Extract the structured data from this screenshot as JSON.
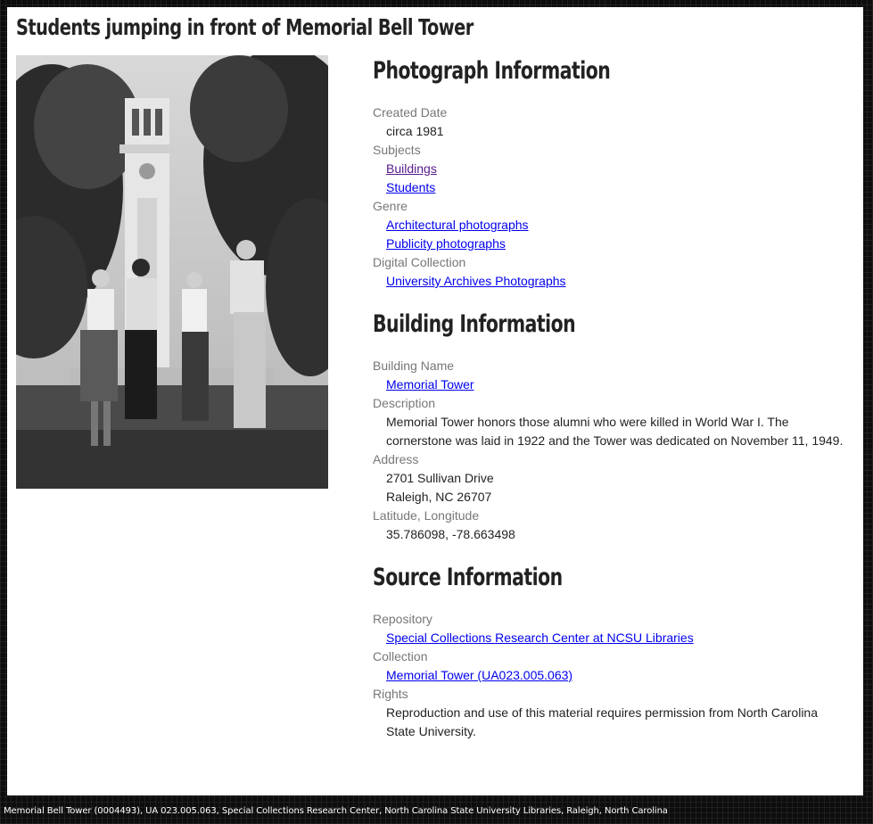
{
  "page": {
    "title": "Students jumping in front of Memorial Bell Tower",
    "footer_caption": "Memorial Bell Tower (0004493), UA 023.005.063, Special Collections Research Center, North Carolina State University Libraries, Raleigh, North Carolina"
  },
  "photo": {
    "description_icon": "black-and-white-photograph"
  },
  "photograph_information": {
    "heading": "Photograph Information",
    "created_date_label": "Created Date",
    "created_date": "circa 1981",
    "subjects_label": "Subjects",
    "subjects": [
      "Buildings",
      "Students"
    ],
    "genre_label": "Genre",
    "genre": [
      "Architectural photographs",
      "Publicity photographs"
    ],
    "digital_collection_label": "Digital Collection",
    "digital_collection": "University Archives Photographs"
  },
  "building_information": {
    "heading": "Building Information",
    "building_name_label": "Building Name",
    "building_name": "Memorial Tower",
    "description_label": "Description",
    "description": "Memorial Tower honors those alumni who were killed in World War I. The cornerstone was laid in 1922 and the Tower was dedicated on November 11, 1949.",
    "address_label": "Address",
    "address_line1": "2701 Sullivan Drive",
    "address_line2": "Raleigh, NC 26707",
    "latlong_label": "Latitude, Longitude",
    "latlong": "35.786098, -78.663498"
  },
  "source_information": {
    "heading": "Source Information",
    "repository_label": "Repository",
    "repository": "Special Collections Research Center at NCSU Libraries",
    "collection_label": "Collection",
    "collection": "Memorial Tower (UA023.005.063)",
    "rights_label": "Rights",
    "rights": "Reproduction and use of this material requires permission from North Carolina State University."
  },
  "colors": {
    "link": "#0000ee",
    "visited_link": "#551a8b",
    "label": "#777777",
    "text": "#222222"
  }
}
